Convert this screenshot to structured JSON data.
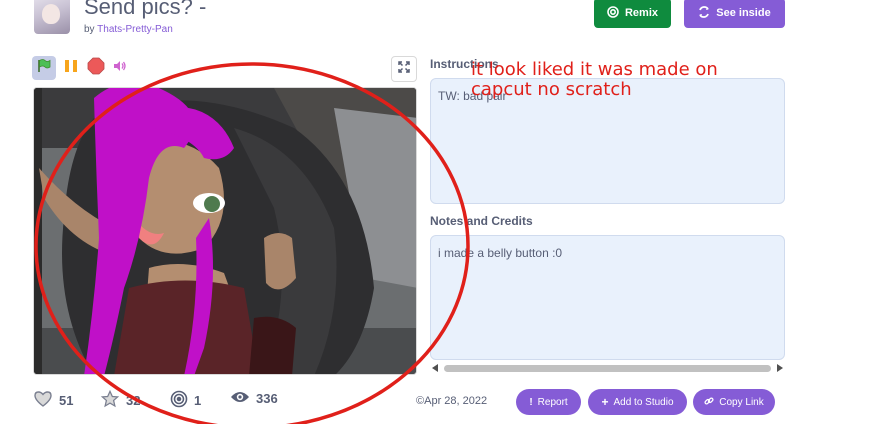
{
  "project": {
    "title": "Send pics? -",
    "by_prefix": "by",
    "author": "Thats-Pretty-Pan"
  },
  "header_buttons": {
    "remix_label": "Remix",
    "see_inside_label": "See inside"
  },
  "instructions": {
    "heading": "Instructions",
    "text": "TW: bad pair"
  },
  "notes": {
    "heading": "Notes and Credits",
    "text": "i made a belly button :0"
  },
  "stats": {
    "loves": "51",
    "favorites": "32",
    "remixes": "1",
    "views": "336"
  },
  "shared_date": "Apr 28, 2022",
  "actions": {
    "report_label": "Report",
    "add_to_studio_label": "Add to Studio",
    "copy_link_label": "Copy Link"
  },
  "annotation": {
    "line1": "it look liked it was made on",
    "line2": "capcut no scratch"
  },
  "colors": {
    "accent": "#855cd6",
    "remix_green": "#0f8b3e",
    "panel_bg": "#e9f1fc",
    "annotation_red": "#e0201a",
    "hair_magenta": "#c010c8"
  },
  "icons": [
    "green-flag-icon",
    "pause-icon",
    "stop-icon",
    "sound-icon",
    "fullscreen-icon",
    "remix-icon",
    "see-inside-icon",
    "heart-icon",
    "star-icon",
    "remix-swirl-icon",
    "eye-icon",
    "copyright-icon",
    "report-icon",
    "plus-icon",
    "link-icon"
  ]
}
